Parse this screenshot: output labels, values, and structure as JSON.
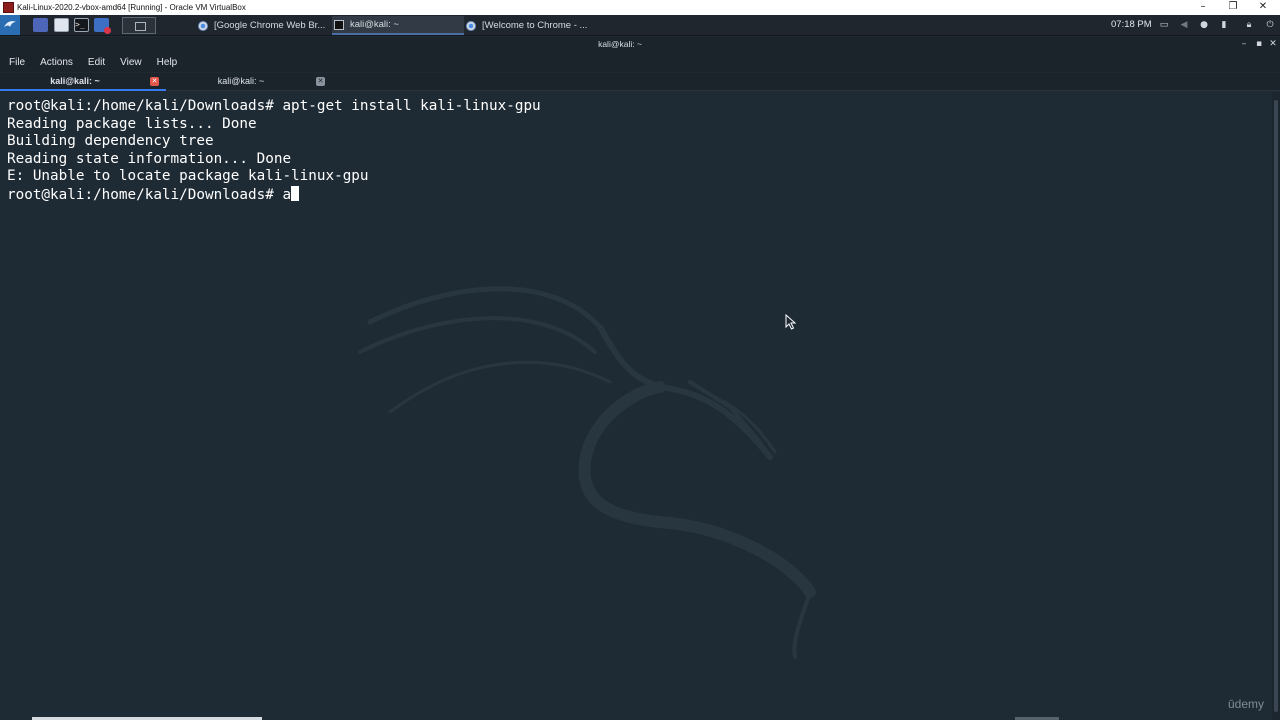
{
  "host_window": {
    "title": "Kali-Linux-2020.2-vbox-amd64 [Running] - Oracle VM VirtualBox",
    "controls": [
      "–",
      "❐",
      "✕"
    ]
  },
  "panel": {
    "tasks": [
      {
        "label": "[Google Chrome Web Br...",
        "icon": "chrome-icon"
      },
      {
        "label": "kali@kali: ~",
        "icon": "terminal-icon",
        "active": true
      },
      {
        "label": "[Welcome to Chrome - ...",
        "icon": "chrome-icon"
      }
    ],
    "clock": "07:18 PM",
    "tray_icons": [
      "display-icon",
      "volume-icon",
      "notification-icon",
      "battery-icon",
      "lock-icon",
      "power-icon"
    ]
  },
  "terminal": {
    "window_title": "kali@kali: ~",
    "menu": [
      "File",
      "Actions",
      "Edit",
      "View",
      "Help"
    ],
    "tabs": [
      {
        "label": "kali@kali: ~",
        "active": true
      },
      {
        "label": "kali@kali: ~",
        "active": false
      }
    ],
    "lines": [
      "root@kali:/home/kali/Downloads# apt-get install kali-linux-gpu",
      "Reading package lists... Done",
      "Building dependency tree",
      "Reading state information... Done",
      "E: Unable to locate package kali-linux-gpu"
    ],
    "prompt": "root@kali:/home/kali/Downloads# ",
    "current_input": "a"
  },
  "watermark": "ūdemy",
  "colors": {
    "terminal_bg": "#1f2b34",
    "panel_bg": "#20262d",
    "accent": "#367bf0",
    "tab_close_active": "#e2574c"
  }
}
